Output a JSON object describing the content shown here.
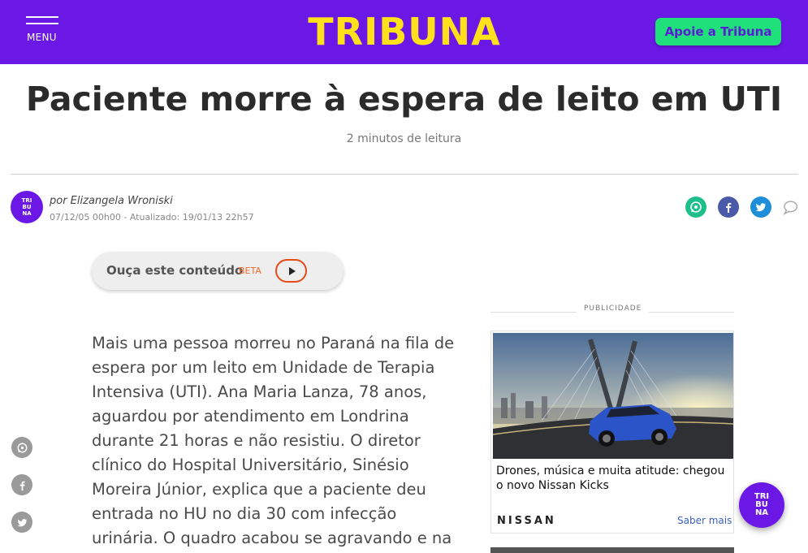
{
  "header": {
    "menu_label": "MENU",
    "logo_text": "TRIBUNA",
    "cta_label": "Apoie a Tribuna",
    "brand_color": "#6b18e6",
    "logo_color": "#ffe01b",
    "cta_color": "#1fe07a"
  },
  "article": {
    "title": "Paciente morre à espera de leito em UTI",
    "reading_time": "2 minutos de leitura",
    "author": "por Elizangela Wroniski",
    "dates": "07/12/05 00h00 - Atualizado: 19/01/13 22h57",
    "avatar_text": "TRI BU NA",
    "body": "Mais uma pessoa morreu no Paraná na fila de espera por um leito em Unidade de Terapia Intensiva (UTI). Ana Maria Lanza, 78 anos, aguardou por atendimento em Londrina durante 21 horas e não resistiu. O diretor clínico do Hospital Universitário, Sinésio Moreira Júnior, explica que a paciente deu entrada no HU no dia 30 com infecção urinária. O quadro acabou se agravando e na segunda-feira ela precisou"
  },
  "share_icons": [
    "whatsapp-icon",
    "facebook-icon",
    "twitter-icon",
    "comment-icon"
  ],
  "audio": {
    "label": "Ouça este conteúdo",
    "badge": "BETA"
  },
  "ad": {
    "label": "PUBLICIDADE",
    "title": "Drones, música e muita atitude: chegou o novo Nissan Kicks",
    "brand": "NISSAN",
    "more": "Saber mais"
  },
  "float_badge": "TRI BU NA"
}
